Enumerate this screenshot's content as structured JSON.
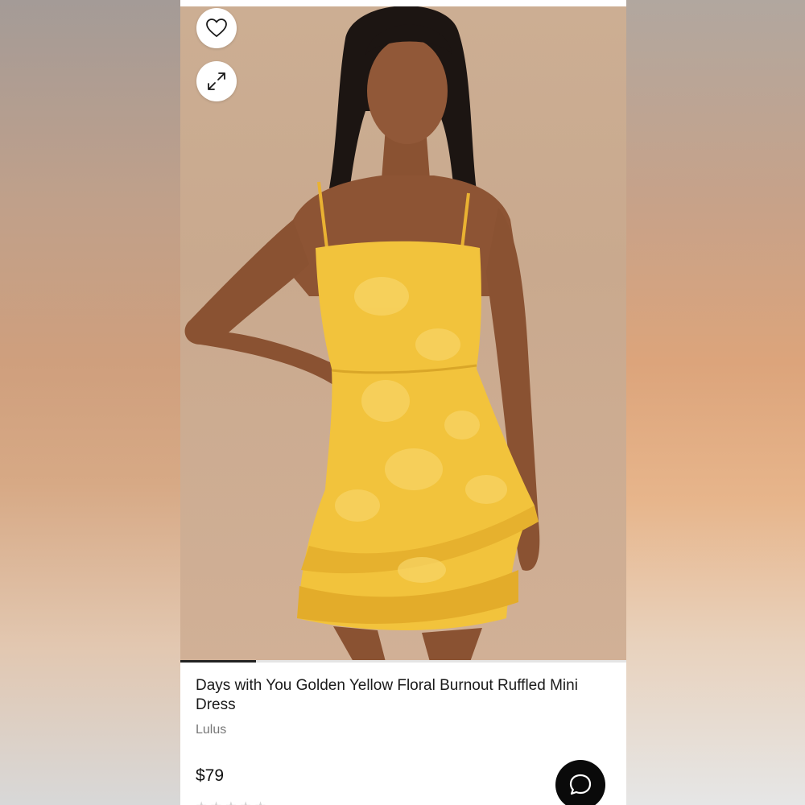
{
  "product": {
    "title": "Days with You Golden Yellow Floral Burnout Ruffled Mini Dress",
    "brand": "Lulus",
    "price": "$79",
    "image_index_fraction": 0.17
  },
  "actions": {
    "favorite_icon": "heart-icon",
    "expand_icon": "expand-icon",
    "chat_icon": "chat-bubble-icon"
  },
  "colors": {
    "dress": "#f2c33c",
    "chat_button": "#0a0a0a",
    "background": "#ffffff"
  }
}
